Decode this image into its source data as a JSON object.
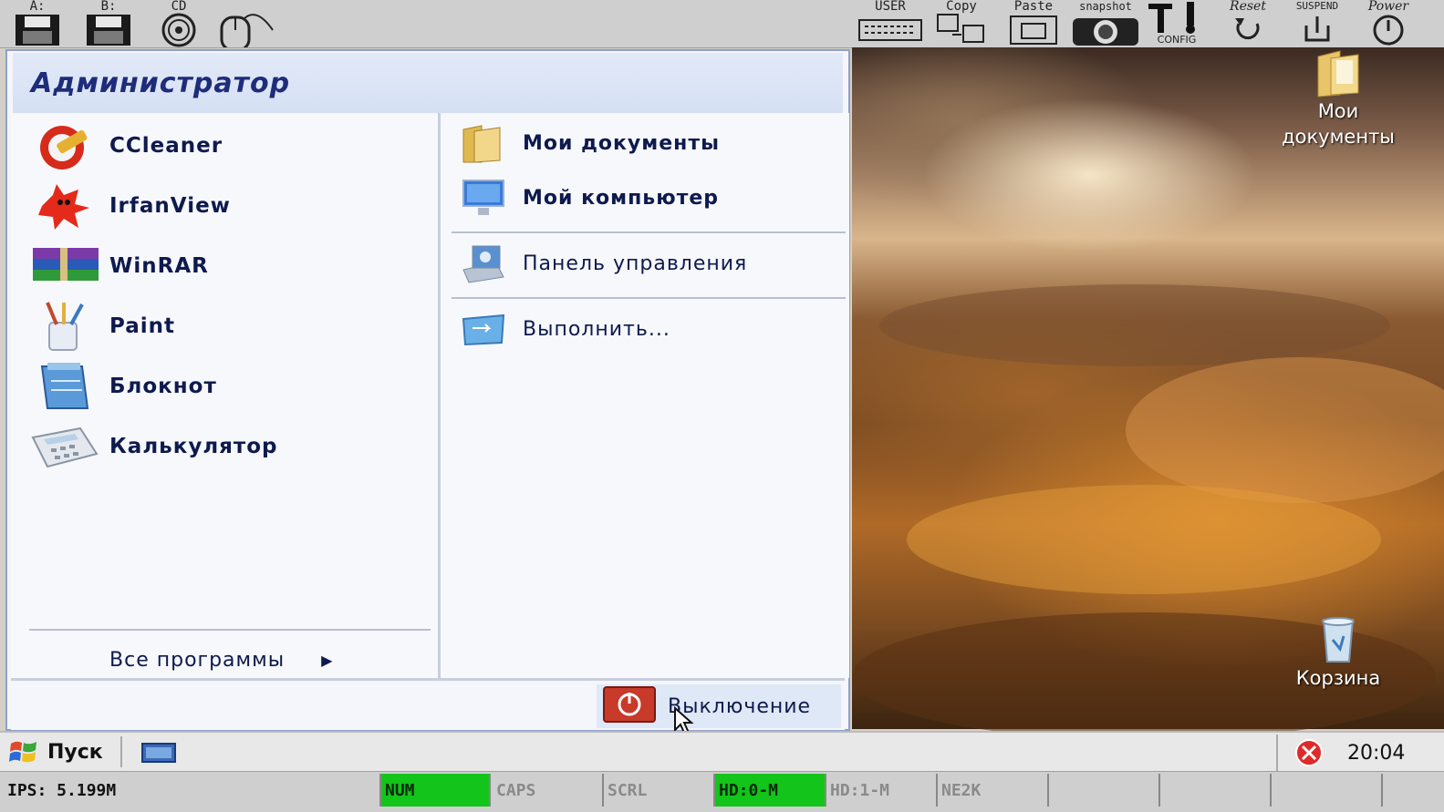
{
  "toolbar": {
    "buttons_left": [
      {
        "caption": "A:",
        "icon": "floppy-a-icon"
      },
      {
        "caption": "B:",
        "icon": "floppy-b-icon"
      },
      {
        "caption": "CD",
        "icon": "cdrom-icon"
      },
      {
        "caption": "",
        "icon": "mouse-icon"
      }
    ],
    "buttons_right": [
      {
        "caption": "USER",
        "icon": "keyboard-icon"
      },
      {
        "caption": "Copy",
        "icon": "copy-icon"
      },
      {
        "caption": "Paste",
        "icon": "paste-icon"
      },
      {
        "caption": "snapshot",
        "icon": "camera-icon"
      },
      {
        "caption": "CONFIG",
        "icon": "config-icon"
      },
      {
        "caption": "Reset",
        "icon": "reset-icon"
      },
      {
        "caption": "SUSPEND",
        "icon": "suspend-icon"
      },
      {
        "caption": "Power",
        "icon": "power-icon"
      }
    ]
  },
  "start_menu": {
    "user_name": "Администратор",
    "programs": [
      {
        "label": "CCleaner",
        "icon": "ccleaner-icon"
      },
      {
        "label": "IrfanView",
        "icon": "irfanview-icon"
      },
      {
        "label": "WinRAR",
        "icon": "winrar-icon"
      },
      {
        "label": "Paint",
        "icon": "paint-icon"
      },
      {
        "label": "Блокнот",
        "icon": "notepad-icon"
      },
      {
        "label": "Калькулятор",
        "icon": "calculator-icon"
      }
    ],
    "all_programs": "Все программы",
    "places": [
      {
        "label": "Мои документы",
        "icon": "my-documents-icon"
      },
      {
        "label": "Мой компьютер",
        "icon": "my-computer-icon"
      },
      {
        "label": "Панель управления",
        "icon": "control-panel-icon"
      },
      {
        "label": "Выполнить...",
        "icon": "run-icon"
      }
    ],
    "shutdown": "Выключение"
  },
  "desktop": {
    "icons": [
      {
        "label_line1": "Мои",
        "label_line2": "документы",
        "icon": "folder-icon"
      },
      {
        "label_line1": "Корзина",
        "label_line2": "",
        "icon": "recycle-bin-icon"
      }
    ]
  },
  "taskbar": {
    "start_label": "Пуск",
    "clock": "20:04"
  },
  "statusbar": {
    "ips": "IPS: 5.199M",
    "indicators": [
      {
        "label": "NUM",
        "active": true
      },
      {
        "label": "CAPS",
        "active": false
      },
      {
        "label": "SCRL",
        "active": false
      },
      {
        "label": "HD:0-M",
        "active": true
      },
      {
        "label": "HD:1-M",
        "active": false
      },
      {
        "label": "NE2K",
        "active": false
      },
      {
        "label": "",
        "active": false
      },
      {
        "label": "",
        "active": false
      },
      {
        "label": "",
        "active": false
      }
    ]
  },
  "colors": {
    "menu_header": "#d6e0f4",
    "menu_text": "#0e1a4e",
    "indicator_on": "#13c41a"
  }
}
